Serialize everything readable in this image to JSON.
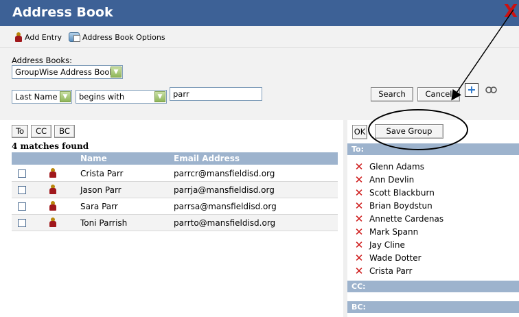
{
  "window": {
    "title": "Address Book",
    "close_glyph": "X"
  },
  "toolbar": {
    "add_entry": "Add Entry",
    "address_book_options": "Address Book Options"
  },
  "search": {
    "address_books_label": "Address Books:",
    "address_book_value": "GroupWise Address Book",
    "field_value": "Last Name",
    "operator_value": "begins with",
    "query_value": "parr",
    "search_button": "Search",
    "cancel_button": "Cancel",
    "plus_glyph": "+"
  },
  "recipients_buttons": {
    "to": "To",
    "cc": "CC",
    "bc": "BC"
  },
  "results": {
    "summary": "4 matches found",
    "columns": {
      "name": "Name",
      "email": "Email Address"
    },
    "rows": [
      {
        "name": "Crista Parr",
        "email": "parrcr@mansfieldisd.org"
      },
      {
        "name": "Jason Parr",
        "email": "parrja@mansfieldisd.org"
      },
      {
        "name": "Sara Parr",
        "email": "parrsa@mansfieldisd.org"
      },
      {
        "name": "Toni Parrish",
        "email": "parrto@mansfieldisd.org"
      }
    ]
  },
  "group": {
    "ok_button": "OK",
    "save_group_button": "Save Group",
    "to_label": "To:",
    "cc_label": "CC:",
    "bc_label": "BC:",
    "remove_glyph": "✕",
    "to_members": [
      "Glenn Adams",
      "Ann Devlin",
      "Scott Blackburn",
      "Brian Boydstun",
      "Annette Cardenas",
      "Mark Spann",
      "Jay Cline",
      "Wade Dotter",
      "Crista Parr"
    ]
  },
  "colors": {
    "title_bar": "#3d6196",
    "header_bar": "#9db3cd",
    "remove_red": "#cc1111"
  }
}
